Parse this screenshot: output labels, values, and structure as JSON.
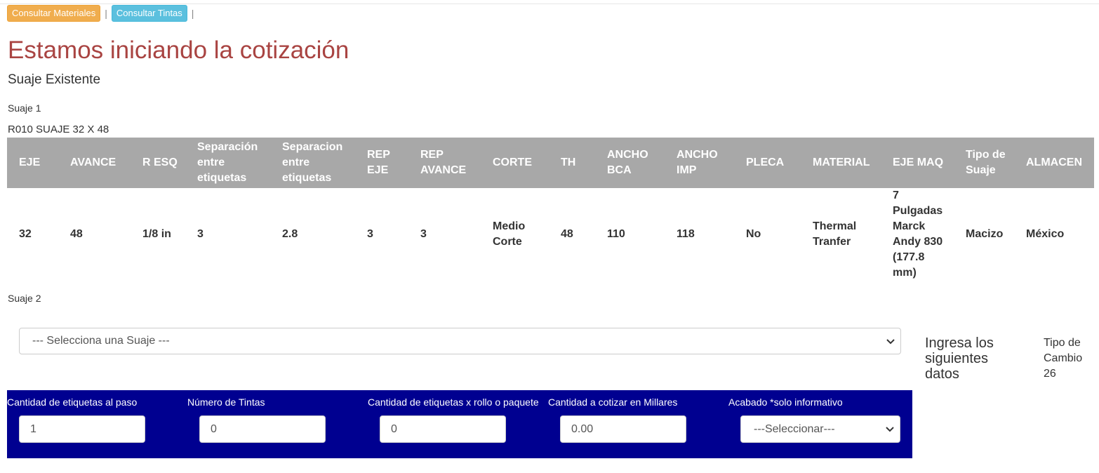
{
  "toolbar": {
    "btn_materiales": "Consultar Materiales",
    "btn_tintas": "Consultar Tintas",
    "separator": "|"
  },
  "title": "Estamos iniciando la cotización",
  "subtitle": "Suaje Existente",
  "suaje1": {
    "label": "Suaje 1",
    "name": "R010 SUAJE 32 X 48",
    "headers": [
      "EJE",
      "AVANCE",
      "R ESQ",
      "Separación entre etiquetas",
      "Separacion entre etiquetas",
      "REP EJE",
      "REP AVANCE",
      "CORTE",
      "TH",
      "ANCHO BCA",
      "ANCHO IMP",
      "PLECA",
      "MATERIAL",
      "EJE MAQ",
      "Tipo de Suaje",
      "ALMACEN"
    ],
    "values": [
      "32",
      "48",
      "1/8 in",
      "3",
      "2.8",
      "3",
      "3",
      "Medio Corte",
      "48",
      "110",
      "118",
      "No",
      "Thermal Tranfer",
      "7 Pulgadas Marck Andy 830 (177.8 mm)",
      "Macizo",
      "México"
    ]
  },
  "suaje2": {
    "label": "Suaje 2",
    "select_value": "--- Selecciona una Suaje ---",
    "chevron_icon": "chevron-down-icon"
  },
  "aside": {
    "ingresa": "Ingresa los siguientes datos",
    "tipo_cambio_label": "Tipo de Cambio",
    "tipo_cambio_value": "26"
  },
  "form": {
    "panel_color": "#000090",
    "fields": [
      {
        "label": "Cantidad de etiquetas al paso",
        "value": "1"
      },
      {
        "label": "Número de Tintas",
        "value": "0"
      },
      {
        "label": "Cantidad de etiquetas x rollo o paquete",
        "value": "0"
      },
      {
        "label": "Cantidad a cotizar en Millares",
        "value": "0.00"
      },
      {
        "label": "Acabado *solo informativo",
        "value": "---Seleccionar---"
      }
    ]
  },
  "colors": {
    "title": "#a94442",
    "table_header_bg": "#a8a8a8",
    "btn_warning": "#f0ad4e",
    "btn_info": "#5bc0de"
  }
}
